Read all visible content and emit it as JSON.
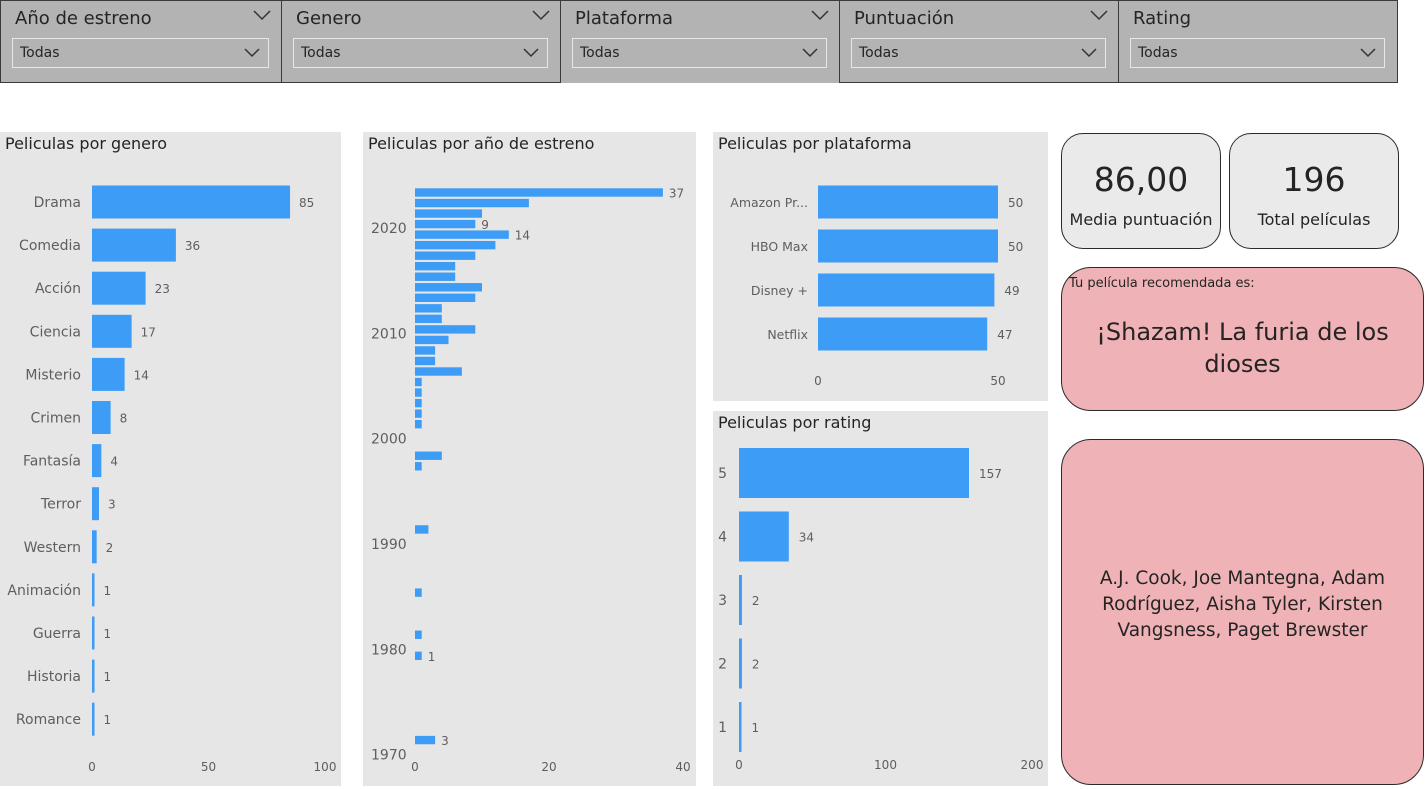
{
  "slicers": [
    {
      "title": "Año de estreno",
      "value": "Todas"
    },
    {
      "title": "Genero",
      "value": "Todas"
    },
    {
      "title": "Plataforma",
      "value": "Todas"
    },
    {
      "title": "Puntuación",
      "value": "Todas"
    },
    {
      "title": "Rating",
      "value": "Todas"
    }
  ],
  "colors": {
    "bar": "#3d9cf5",
    "panel": "#e6e6e6",
    "slicer": "#b3b3b3",
    "recommendation": "#efb3b7"
  },
  "chart_data": [
    {
      "id": "genre",
      "type": "bar",
      "orientation": "horizontal",
      "title": "Peliculas por genero",
      "categories": [
        "Drama",
        "Comedia",
        "Acción",
        "Ciencia",
        "Misterio",
        "Crimen",
        "Fantasía",
        "Terror",
        "Western",
        "Animación",
        "Guerra",
        "Historia",
        "Romance"
      ],
      "values": [
        85,
        36,
        23,
        17,
        14,
        8,
        4,
        3,
        2,
        1,
        1,
        1,
        1
      ],
      "data_labels": [
        "85",
        "36",
        "23",
        "17",
        "14",
        "8",
        "4",
        "3",
        "2",
        "1",
        "1",
        "1",
        "1"
      ],
      "xlim": [
        0,
        100
      ],
      "xticks": [
        "0",
        "50",
        "100"
      ],
      "grid": false
    },
    {
      "id": "year",
      "type": "bar",
      "orientation": "horizontal",
      "title": "Peliculas por año de estreno",
      "y": [
        2023,
        2022,
        2021,
        2020,
        2019,
        2018,
        2017,
        2016,
        2015,
        2014,
        2013,
        2012,
        2011,
        2010,
        2009,
        2008,
        2007,
        2006,
        2005,
        2004,
        2003,
        2002,
        2001,
        1998,
        1997,
        1991,
        1985,
        1981,
        1979,
        1971
      ],
      "values": [
        37,
        17,
        10,
        9,
        14,
        12,
        9,
        6,
        6,
        10,
        9,
        4,
        4,
        9,
        5,
        3,
        3,
        7,
        1,
        1,
        1,
        1,
        1,
        4,
        1,
        2,
        1,
        1,
        1,
        3
      ],
      "labeled_points": [
        {
          "year": 2023,
          "label": "37"
        },
        {
          "year": 2020,
          "label": "9"
        },
        {
          "year": 2019,
          "label": "14"
        },
        {
          "year": 1979,
          "label": "1"
        },
        {
          "year": 1971,
          "label": "3"
        }
      ],
      "yticks": [
        "2020",
        "2010",
        "2000",
        "1990",
        "1980",
        "1970"
      ],
      "xlim": [
        0,
        40
      ],
      "xticks": [
        "0",
        "20",
        "40"
      ],
      "grid": false
    },
    {
      "id": "platform",
      "type": "bar",
      "orientation": "horizontal",
      "title": "Peliculas por plataforma",
      "categories": [
        "Amazon Pr...",
        "HBO Max",
        "Disney +",
        "Netflix"
      ],
      "values": [
        50,
        50,
        49,
        47
      ],
      "data_labels": [
        "50",
        "50",
        "49",
        "47"
      ],
      "xlim": [
        0,
        50
      ],
      "xticks": [
        "0",
        "50"
      ],
      "grid": false
    },
    {
      "id": "rating",
      "type": "bar",
      "orientation": "horizontal",
      "title": "Peliculas por rating",
      "categories": [
        "5",
        "4",
        "3",
        "2",
        "1"
      ],
      "values": [
        157,
        34,
        2,
        2,
        1
      ],
      "data_labels": [
        "157",
        "34",
        "2",
        "2",
        "1"
      ],
      "xlim": [
        0,
        200
      ],
      "xticks": [
        "0",
        "100",
        "200"
      ],
      "grid": false
    }
  ],
  "cards": [
    {
      "value": "86,00",
      "label": "Media puntuación"
    },
    {
      "value": "196",
      "label": "Total películas"
    }
  ],
  "recommendation": {
    "label": "Tu película recomendada es:",
    "title": "¡Shazam! La furia de los dioses"
  },
  "cast": {
    "text": "A.J. Cook, Joe Mantegna, Adam Rodríguez, Aisha Tyler, Kirsten Vangsness, Paget Brewster"
  }
}
